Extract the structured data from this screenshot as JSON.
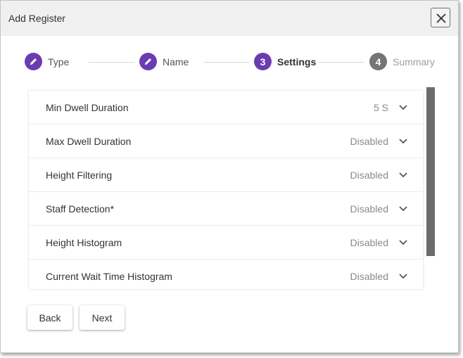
{
  "dialog": {
    "title": "Add Register"
  },
  "stepper": {
    "steps": [
      {
        "label": "Type",
        "state": "completed",
        "icon": "pencil-icon"
      },
      {
        "label": "Name",
        "state": "completed",
        "icon": "pencil-icon"
      },
      {
        "label": "Settings",
        "number": "3",
        "state": "active"
      },
      {
        "label": "Summary",
        "number": "4",
        "state": "upcoming"
      }
    ]
  },
  "settings": {
    "rows": [
      {
        "label": "Min Dwell Duration",
        "value": "5 S"
      },
      {
        "label": "Max Dwell Duration",
        "value": "Disabled"
      },
      {
        "label": "Height Filtering",
        "value": "Disabled"
      },
      {
        "label": "Staff Detection*",
        "value": "Disabled"
      },
      {
        "label": "Height Histogram",
        "value": "Disabled"
      },
      {
        "label": "Current Wait Time Histogram",
        "value": "Disabled"
      }
    ]
  },
  "footer": {
    "back_label": "Back",
    "next_label": "Next"
  },
  "colors": {
    "accent": "#6a3cb0",
    "inactive": "#757575",
    "titlebar": "#f0f0f0"
  }
}
